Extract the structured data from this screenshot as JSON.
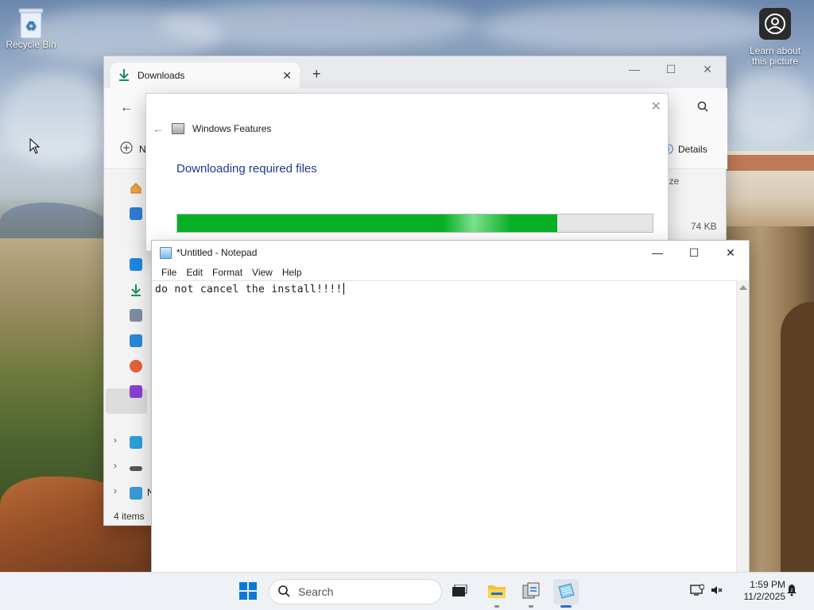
{
  "desktop": {
    "recycle_bin_label": "Recycle Bin",
    "learn_label": "Learn about this picture"
  },
  "explorer": {
    "tab_title": "Downloads",
    "new_button_label": "N",
    "details_label": "Details",
    "size_header": "ize",
    "file_size": "74 KB",
    "status_items": "4 items",
    "nav_partial_label": "N",
    "accent": "#1a8f5a"
  },
  "features_dialog": {
    "title": "Windows Features",
    "message": "Downloading required files",
    "progress": 0.8,
    "progress_color": "#06b025"
  },
  "notepad": {
    "title": "*Untitled - Notepad",
    "menu": [
      "File",
      "Edit",
      "Format",
      "View",
      "Help"
    ],
    "content": "do not cancel the install!!!!"
  },
  "taskbar": {
    "search_placeholder": "Search",
    "time": "1:59 PM",
    "date": "11/2/2025",
    "accent": "#1f6fd6"
  }
}
